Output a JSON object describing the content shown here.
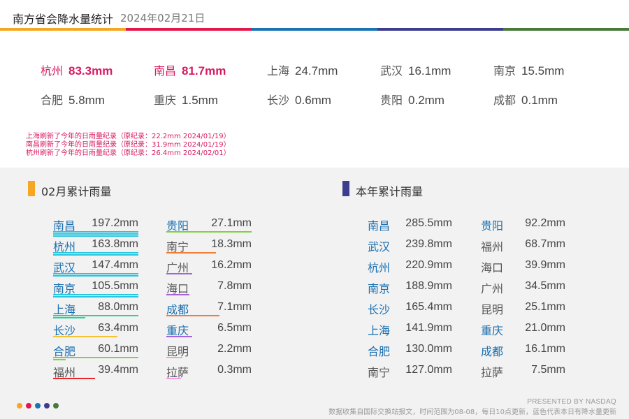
{
  "header": {
    "title": "南方省会降水量统计",
    "date": "2024年02月21日"
  },
  "colors": {
    "band": [
      "#f5a623",
      "#e0184c",
      "#1a73b5",
      "#3d3d8f",
      "#4a7a3a"
    ],
    "highlight": "#d81b60",
    "city_blue": "#1a6fb0",
    "city_gray": "#555555"
  },
  "today": [
    {
      "city": "杭州",
      "value": "83.3mm",
      "highlight": true
    },
    {
      "city": "南昌",
      "value": "81.7mm",
      "highlight": true
    },
    {
      "city": "上海",
      "value": "24.7mm",
      "highlight": false
    },
    {
      "city": "武汉",
      "value": "16.1mm",
      "highlight": false
    },
    {
      "city": "南京",
      "value": "15.5mm",
      "highlight": false
    },
    {
      "city": "合肥",
      "value": "5.8mm",
      "highlight": false
    },
    {
      "city": "重庆",
      "value": "1.5mm",
      "highlight": false
    },
    {
      "city": "长沙",
      "value": "0.6mm",
      "highlight": false
    },
    {
      "city": "贵阳",
      "value": "0.2mm",
      "highlight": false
    },
    {
      "city": "成都",
      "value": "0.1mm",
      "highlight": false
    }
  ],
  "records": [
    "上海刷新了今年的日雨量纪录（原纪录：22.2mm 2024/01/19）",
    "南昌刷新了今年的日雨量纪录（原纪录：31.9mm 2024/01/19）",
    "杭州刷新了今年的日雨量纪录（原纪录：26.4mm 2024/02/01）"
  ],
  "month": {
    "title": "02月累计雨量",
    "mark_color": "#f5a623",
    "left": [
      {
        "city": "南昌",
        "value": "197.2mm",
        "blue": true,
        "bars": [
          {
            "c": "#29c6e0",
            "f": 1.0
          },
          {
            "c": "#29c6e0",
            "f": 1.0
          },
          {
            "c": "#29c6e0",
            "f": 1.0
          }
        ]
      },
      {
        "city": "杭州",
        "value": "163.8mm",
        "blue": true,
        "bars": [
          {
            "c": "#29c6e0",
            "f": 1.0
          },
          {
            "c": "#29c6e0",
            "f": 1.0
          }
        ]
      },
      {
        "city": "武汉",
        "value": "147.4mm",
        "blue": true,
        "bars": [
          {
            "c": "#29c6e0",
            "f": 1.0
          },
          {
            "c": "#29c6e0",
            "f": 1.0
          }
        ]
      },
      {
        "city": "南京",
        "value": "105.5mm",
        "blue": true,
        "bars": [
          {
            "c": "#29c6e0",
            "f": 1.0
          },
          {
            "c": "#29c6e0",
            "f": 1.0
          }
        ]
      },
      {
        "city": "上海",
        "value": "88.0mm",
        "blue": true,
        "bars": [
          {
            "c": "#2ecf9a",
            "f": 1.0
          },
          {
            "c": "#2ecf9a",
            "f": 0.38
          }
        ]
      },
      {
        "city": "长沙",
        "value": "63.4mm",
        "blue": true,
        "bars": [
          {
            "c": "#f7c232",
            "f": 0.75
          }
        ]
      },
      {
        "city": "合肥",
        "value": "60.1mm",
        "blue": true,
        "bars": [
          {
            "c": "#7fd43a",
            "f": 1.0
          },
          {
            "c": "#7fd43a",
            "f": 0.15
          }
        ]
      },
      {
        "city": "福州",
        "value": "39.4mm",
        "blue": false,
        "bars": [
          {
            "c": "#e8262b",
            "f": 0.49
          }
        ]
      }
    ],
    "right": [
      {
        "city": "贵阳",
        "value": "27.1mm",
        "blue": true,
        "bars": [
          {
            "c": "#7fd43a",
            "f": 1.0
          }
        ]
      },
      {
        "city": "南宁",
        "value": "18.3mm",
        "blue": false,
        "bars": [
          {
            "c": "#f07d32",
            "f": 0.58
          }
        ]
      },
      {
        "city": "广州",
        "value": "16.2mm",
        "blue": false,
        "bars": [
          {
            "c": "#a463d8",
            "f": 0.3
          }
        ]
      },
      {
        "city": "海口",
        "value": "7.8mm",
        "blue": false,
        "bars": [
          {
            "c": "#a463d8",
            "f": 0.27
          }
        ]
      },
      {
        "city": "成都",
        "value": "7.1mm",
        "blue": true,
        "bars": [
          {
            "c": "#f07d32",
            "f": 0.62
          }
        ]
      },
      {
        "city": "重庆",
        "value": "6.5mm",
        "blue": true,
        "bars": [
          {
            "c": "#a463d8",
            "f": 0.3
          }
        ]
      },
      {
        "city": "昆明",
        "value": "2.2mm",
        "blue": false,
        "bars": [
          {
            "c": "#f0a0e0",
            "f": 0.19
          }
        ]
      },
      {
        "city": "拉萨",
        "value": "0.3mm",
        "blue": false,
        "bars": [
          {
            "c": "#f0a0e0",
            "f": 0.17
          }
        ]
      }
    ]
  },
  "year": {
    "title": "本年累计雨量",
    "mark_color": "#3d3d8f",
    "left": [
      {
        "city": "南昌",
        "value": "285.5mm",
        "blue": true
      },
      {
        "city": "武汉",
        "value": "239.8mm",
        "blue": true
      },
      {
        "city": "杭州",
        "value": "220.9mm",
        "blue": true
      },
      {
        "city": "南京",
        "value": "188.9mm",
        "blue": true
      },
      {
        "city": "长沙",
        "value": "165.4mm",
        "blue": true
      },
      {
        "city": "上海",
        "value": "141.9mm",
        "blue": true
      },
      {
        "city": "合肥",
        "value": "130.0mm",
        "blue": true
      },
      {
        "city": "南宁",
        "value": "127.0mm",
        "blue": false
      }
    ],
    "right": [
      {
        "city": "贵阳",
        "value": "92.2mm",
        "blue": true
      },
      {
        "city": "福州",
        "value": "68.7mm",
        "blue": false
      },
      {
        "city": "海口",
        "value": "39.9mm",
        "blue": false
      },
      {
        "city": "广州",
        "value": "34.5mm",
        "blue": false
      },
      {
        "city": "昆明",
        "value": "25.1mm",
        "blue": false
      },
      {
        "city": "重庆",
        "value": "21.0mm",
        "blue": true
      },
      {
        "city": "成都",
        "value": "16.1mm",
        "blue": true
      },
      {
        "city": "拉萨",
        "value": "7.5mm",
        "blue": false
      }
    ]
  },
  "footer": {
    "presented": "PRESENTED BY NASDAQ",
    "note": "数据收集自国际交换站报文，时间范围为08-08，每日10点更新，蓝色代表本日有降水量更新",
    "dots": [
      "#f5a623",
      "#e0184c",
      "#1a73b5",
      "#3d3d8f",
      "#4a7a3a"
    ]
  }
}
